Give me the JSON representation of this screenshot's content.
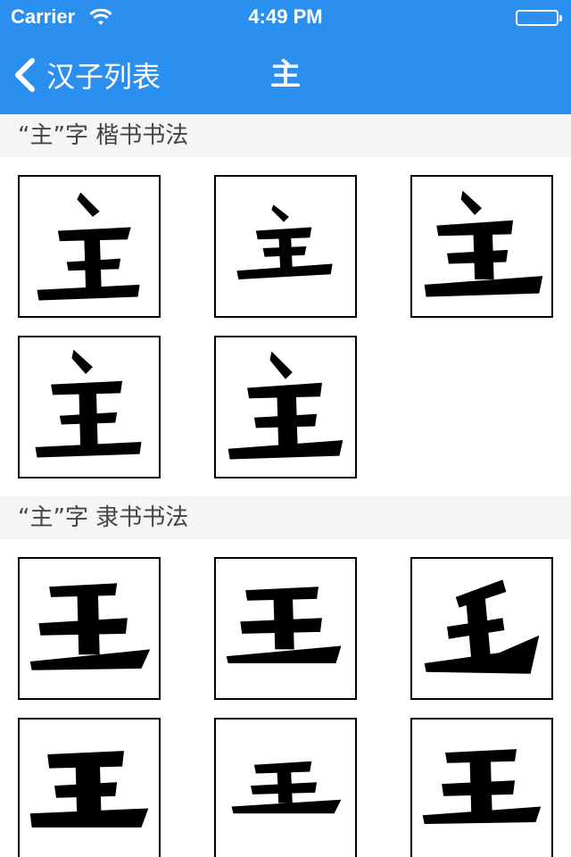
{
  "status_bar": {
    "carrier": "Carrier",
    "time": "4:49 PM"
  },
  "nav": {
    "back_label": "汉子列表",
    "title": "主"
  },
  "sections": [
    {
      "title": "“主”字  楷书书法",
      "tiles": [
        "楷书-1",
        "楷书-2",
        "楷书-3",
        "楷书-4",
        "楷书-5"
      ]
    },
    {
      "title": "“主”字  隶书书法",
      "tiles": [
        "隶书-1",
        "隶书-2",
        "隶书-3",
        "隶书-4",
        "隶书-5",
        "隶书-6"
      ]
    }
  ],
  "colors": {
    "accent": "#2b8ff0",
    "header_bg": "#f5f5f5",
    "ink": "#000000"
  }
}
